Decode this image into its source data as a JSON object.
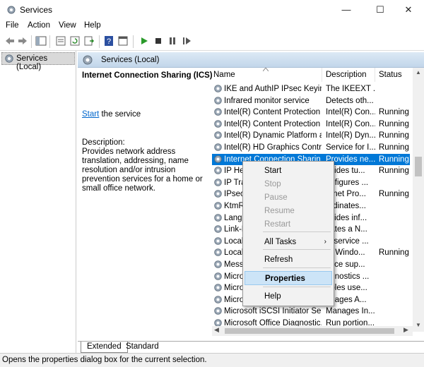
{
  "window": {
    "title": "Services"
  },
  "menu": [
    "File",
    "Action",
    "View",
    "Help"
  ],
  "tree": {
    "root": "Services (Local)"
  },
  "panel": {
    "header": "Services (Local)"
  },
  "details": {
    "service_title": "Internet Connection Sharing (ICS)",
    "start_link": "Start",
    "start_suffix": " the service",
    "description_label": "Description:",
    "description": "Provides network address translation, addressing, name resolution and/or intrusion prevention services for a home or small office network."
  },
  "columns": [
    "Name",
    "Description",
    "Status"
  ],
  "rows": [
    {
      "name": "IKE and AuthIP IPsec Keying...",
      "desc": "The IKEEXT ...",
      "status": ""
    },
    {
      "name": "Infrared monitor service",
      "desc": "Detects oth...",
      "status": ""
    },
    {
      "name": "Intel(R) Content Protection ...",
      "desc": "Intel(R) Con...",
      "status": "Running"
    },
    {
      "name": "Intel(R) Content Protection ...",
      "desc": "Intel(R) Con...",
      "status": "Running"
    },
    {
      "name": "Intel(R) Dynamic Platform a...",
      "desc": "Intel(R) Dyn...",
      "status": "Running"
    },
    {
      "name": "Intel(R) HD Graphics Contro...",
      "desc": "Service for I...",
      "status": "Running"
    },
    {
      "name": "Internet Connection Sharin...",
      "desc": "Provides ne...",
      "status": "Running"
    },
    {
      "name": "IP Hel",
      "desc": "ovides tu...",
      "status": "Running"
    },
    {
      "name": "IP Tra",
      "desc": "onfigures ...",
      "status": ""
    },
    {
      "name": "IPsec",
      "desc": "ernet Pro...",
      "status": "Running"
    },
    {
      "name": "KtmR",
      "desc": "ordinates...",
      "status": ""
    },
    {
      "name": "Langu",
      "desc": "ovides inf...",
      "status": ""
    },
    {
      "name": "Link-L",
      "desc": "eates a N...",
      "status": ""
    },
    {
      "name": "Local",
      "desc": "is service ...",
      "status": ""
    },
    {
      "name": "Local",
      "desc": "re Windo...",
      "status": "Running"
    },
    {
      "name": "Messa",
      "desc": "rvice sup...",
      "status": ""
    },
    {
      "name": "Micro",
      "desc": "agnostics ...",
      "status": ""
    },
    {
      "name": "Micro",
      "desc": "ables use...",
      "status": ""
    },
    {
      "name": "Micro",
      "desc": "anages A...",
      "status": ""
    },
    {
      "name": "Microsoft iSCSI Initiator Ser...",
      "desc": "Manages In...",
      "status": ""
    },
    {
      "name": "Microsoft Office Diagnostic...",
      "desc": "Run portion...",
      "status": ""
    }
  ],
  "context_menu": {
    "start": "Start",
    "stop": "Stop",
    "pause": "Pause",
    "resume": "Resume",
    "restart": "Restart",
    "all_tasks": "All Tasks",
    "refresh": "Refresh",
    "properties": "Properties",
    "help": "Help"
  },
  "tabs": {
    "extended": "Extended",
    "standard": "Standard"
  },
  "status_bar": "Opens the properties dialog box for the current selection.",
  "colors": {
    "selection": "#0078d7",
    "highlight": "#cce4f7",
    "link": "#0066cc"
  }
}
